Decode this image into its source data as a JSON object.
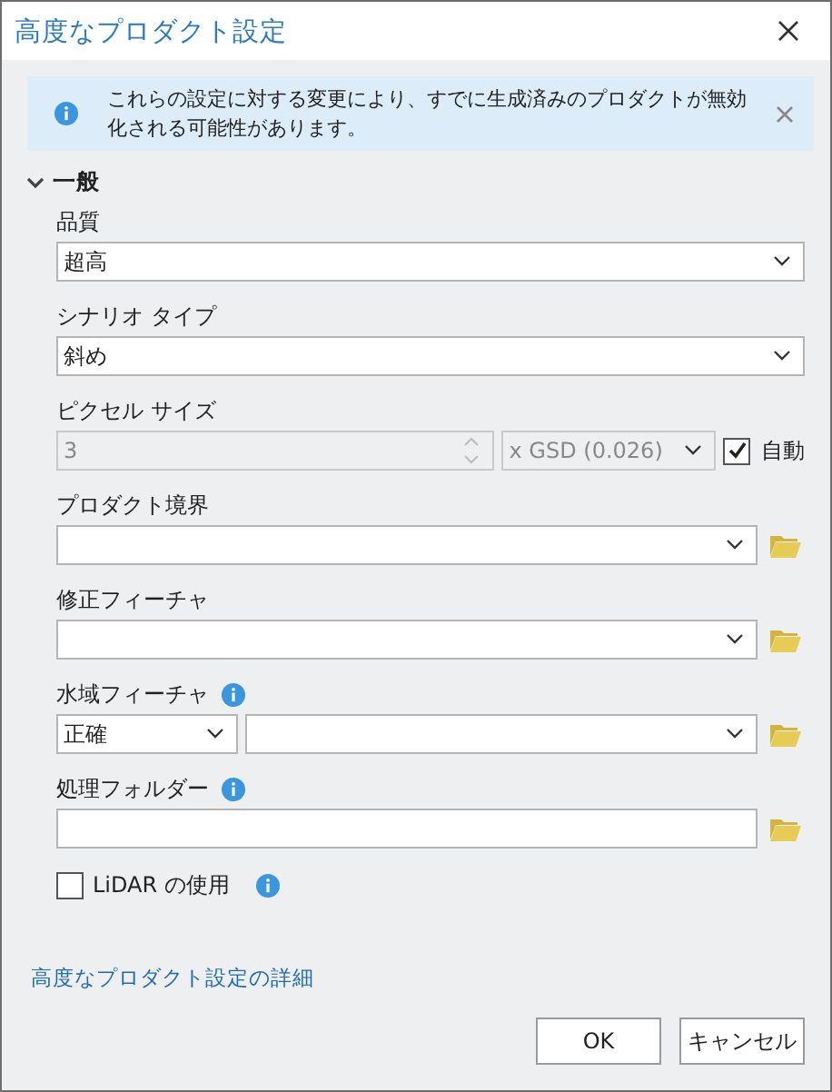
{
  "window": {
    "title": "高度なプロダクト設定"
  },
  "banner": {
    "message": "これらの設定に対する変更により、すでに生成済みのプロダクトが無効化される可能性があります。"
  },
  "section": {
    "title": "一般",
    "expanded": true
  },
  "fields": [
    {
      "kind": "select",
      "label": "品質",
      "value": "超高"
    },
    {
      "kind": "select",
      "label": "シナリオ タイプ",
      "value": "斜め"
    },
    {
      "kind": "pixel",
      "label": "ピクセル サイズ",
      "value": "3",
      "unit": "x GSD (0.026)",
      "disabled": true,
      "auto_label": "自動",
      "auto_checked": true
    },
    {
      "kind": "browse",
      "label": "プロダクト境界",
      "info": false
    },
    {
      "kind": "browse",
      "label": "修正フィーチャ",
      "info": false
    },
    {
      "kind": "browse_mode",
      "label": "水域フィーチャ",
      "info": true,
      "mode": "正確"
    },
    {
      "kind": "folder",
      "label": "処理フォルダー",
      "info": true
    },
    {
      "kind": "checkbox",
      "label": "LiDAR の使用",
      "checked": false,
      "info": true
    }
  ],
  "link": "高度なプロダクト設定の詳細",
  "buttons": [
    {
      "label": "OK"
    },
    {
      "label": "キャンセル"
    }
  ]
}
